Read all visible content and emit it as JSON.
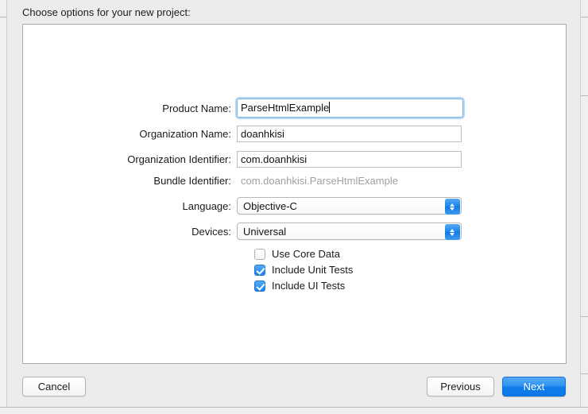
{
  "dialog": {
    "title": "Choose options for your new project:"
  },
  "form": {
    "fields": [
      {
        "label": "Product Name:",
        "value": "ParseHtmlExample",
        "type": "text",
        "focused": true,
        "name": "product-name"
      },
      {
        "label": "Organization Name:",
        "value": "doanhkisi",
        "type": "text",
        "focused": false,
        "name": "organization-name"
      },
      {
        "label": "Organization Identifier:",
        "value": "com.doanhkisi",
        "type": "text",
        "focused": false,
        "name": "organization-identifier"
      },
      {
        "label": "Bundle Identifier:",
        "value": "com.doanhkisi.ParseHtmlExample",
        "type": "static",
        "name": "bundle-identifier"
      },
      {
        "label": "Language:",
        "value": "Objective-C",
        "type": "popup",
        "name": "language"
      },
      {
        "label": "Devices:",
        "value": "Universal",
        "type": "popup",
        "name": "devices"
      }
    ],
    "checkboxes": [
      {
        "label": "Use Core Data",
        "checked": false,
        "name": "use-core-data"
      },
      {
        "label": "Include Unit Tests",
        "checked": true,
        "name": "include-unit-tests"
      },
      {
        "label": "Include UI Tests",
        "checked": true,
        "name": "include-ui-tests"
      }
    ]
  },
  "footer": {
    "cancel_label": "Cancel",
    "previous_label": "Previous",
    "next_label": "Next"
  },
  "colors": {
    "accent": "#1f86ed",
    "focus_ring": "#b8d8f5",
    "sheet_background": "#ececec",
    "panel_background": "#ffffff",
    "static_text": "#a0a0a0"
  },
  "icons": {
    "stepper_up": "chevron-up-icon",
    "stepper_down": "chevron-down-icon",
    "checkmark": "checkmark-icon"
  }
}
